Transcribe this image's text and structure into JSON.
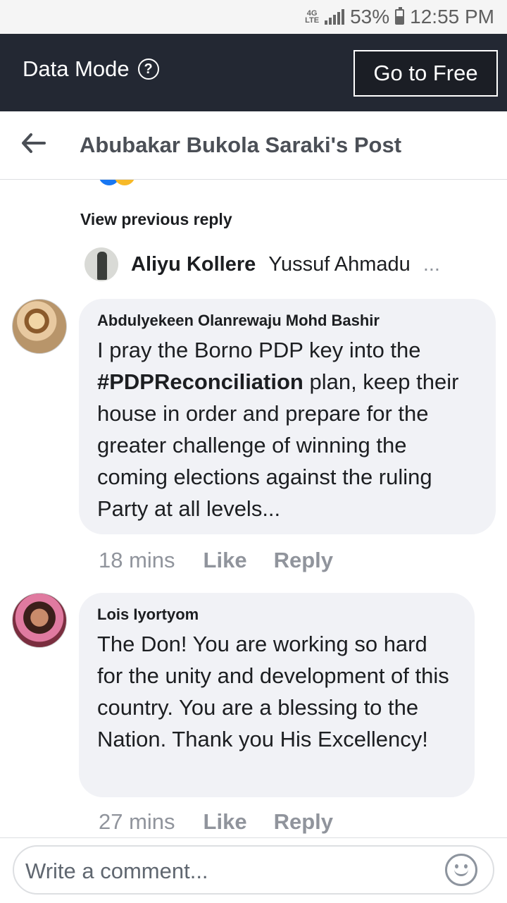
{
  "status_bar": {
    "network": "4G LTE",
    "battery": "53%",
    "battery_level": 0.53,
    "time": "12:55 PM"
  },
  "data_bar": {
    "mode_label": "Data Mode",
    "help_symbol": "?",
    "go_free_label": "Go to Free",
    "background_color": "#232833"
  },
  "header": {
    "title": "Abubakar Bukola Saraki's Post"
  },
  "view_previous": "View previous reply",
  "reply_preview": {
    "name": "Aliyu Kollere",
    "snippet": "Yussuf Ahmadu",
    "ellipsis": "..."
  },
  "comments": [
    {
      "author": "Abdulyekeen Olanrewaju Mohd Bashir",
      "text_before": "I pray the Borno PDP key into the ",
      "hashtag": "#PDPReconciliation",
      "text_after": " plan, keep their house in order and prepare for the greater challenge of winning the coming elections against the ruling Party at all levels...",
      "time": "18 mins",
      "like": "Like",
      "reply": "Reply"
    },
    {
      "author": "Lois Iyortyom",
      "text": "The Don! You are working so hard for the unity and development of this country. You are a blessing to the Nation. Thank you His Excellency!",
      "time": "27 mins",
      "like": "Like",
      "reply": "Reply"
    }
  ],
  "composer": {
    "placeholder": "Write a comment..."
  },
  "colors": {
    "bubble": "#f1f2f6",
    "meta_text": "#90949c",
    "dark_bar": "#232833"
  }
}
